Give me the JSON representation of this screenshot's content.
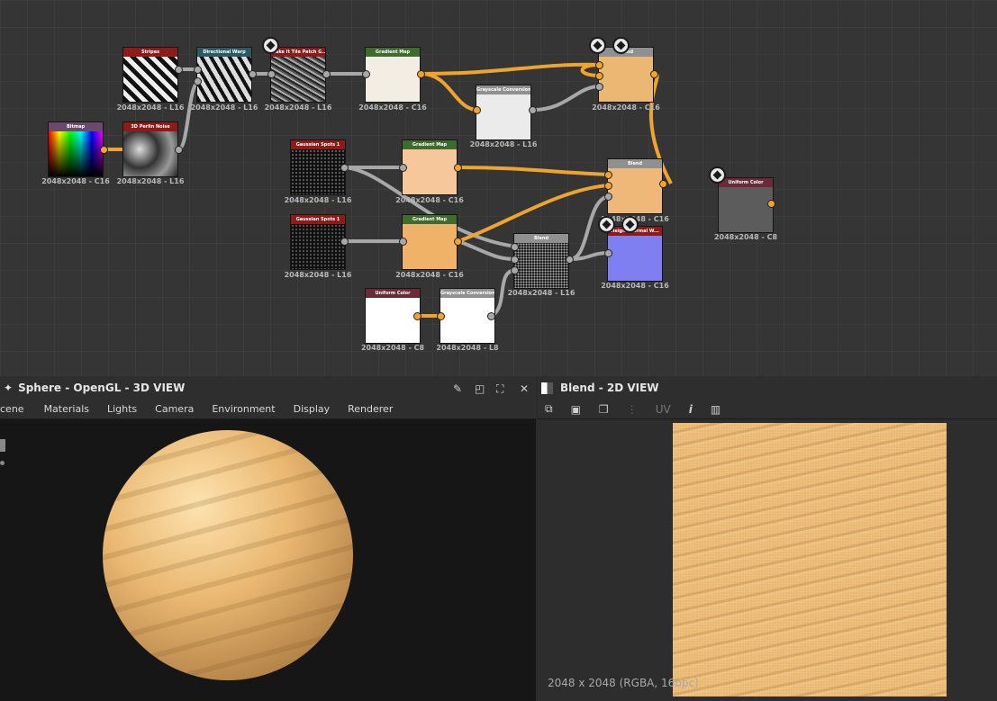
{
  "nodes": [
    {
      "title": "Stripes",
      "res": "2048x2048 - L16"
    },
    {
      "title": "Directional Warp",
      "res": "2048x2048 - L16"
    },
    {
      "title": "Make It Tile Patch G...",
      "res": "2048x2048 - L16"
    },
    {
      "title": "Gradient Map",
      "res": "2048x2048 - C16"
    },
    {
      "title": "Grayscale Conversion",
      "res": "2048x2048 - L16"
    },
    {
      "title": "Blend",
      "res": "2048x2048 - C16"
    },
    {
      "title": "Bitmap",
      "res": "2048x2048 - C16"
    },
    {
      "title": "3D Perlin Noise",
      "res": "2048x2048 - L16"
    },
    {
      "title": "Gaussian Spots 1",
      "res": "2048x2048 - L16"
    },
    {
      "title": "Gradient Map",
      "res": "2048x2048 - C16"
    },
    {
      "title": "Blend",
      "res": "2048x2048 - C16"
    },
    {
      "title": "Uniform Color",
      "res": "2048x2048 - C8"
    },
    {
      "title": "Gaussian Spots 1",
      "res": "2048x2048 - L16"
    },
    {
      "title": "Gradient Map",
      "res": "2048x2048 - C16"
    },
    {
      "title": "Blend",
      "res": "2048x2048 - L16"
    },
    {
      "title": "Height Normal W...",
      "res": "2048x2048 - C16"
    },
    {
      "title": "Uniform Color",
      "res": "2048x2048 - C8"
    },
    {
      "title": "Grayscale Conversion",
      "res": "2048x2048 - L8"
    }
  ],
  "view3d": {
    "title": "Sphere - OpenGL - 3D VIEW",
    "menu": [
      "cene",
      "Materials",
      "Lights",
      "Camera",
      "Environment",
      "Display",
      "Renderer"
    ]
  },
  "view2d": {
    "title": "Blend - 2D VIEW",
    "uv_label": "UV",
    "info_label": "i",
    "status": "2048 x 2048 (RGBA, 16bpc)"
  },
  "colors": {
    "port_orange": "#f0a430",
    "sand": "#eab872",
    "panel_bg": "#1f1f1f"
  }
}
